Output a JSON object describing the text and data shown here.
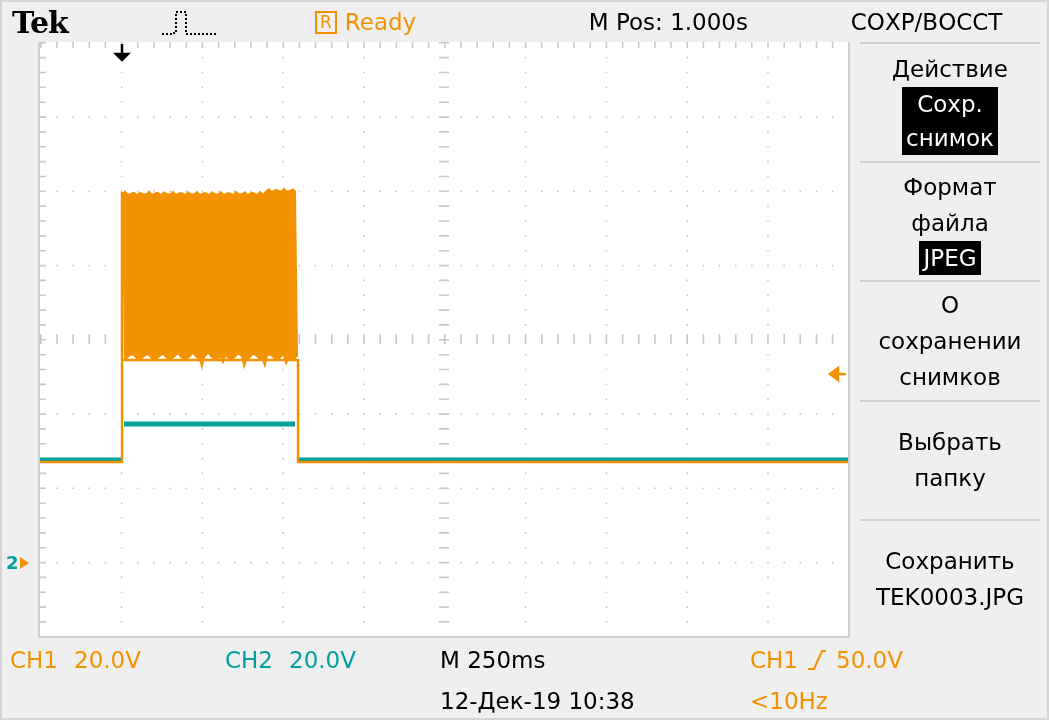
{
  "header": {
    "logo": "Tek",
    "run_badge": "R",
    "run_status": "Ready",
    "position": "M Pos: 1.000s",
    "menu_title": "СОХР/ВОССТ"
  },
  "screen": {
    "marker": "2"
  },
  "menu": [
    {
      "label": "Действие",
      "value": "Сохр.\nснимок"
    },
    {
      "label": "Формат\nфайла",
      "value": "JPEG"
    },
    {
      "label": "О\nсохранении\nснимков"
    },
    {
      "label": "Выбрать\nпапку"
    },
    {
      "label": "Сохранить\nTEK0003.JPG"
    }
  ],
  "footer": {
    "channels": [
      {
        "name": "CH1",
        "scale": "20.0V",
        "color": "#f39200"
      },
      {
        "name": "CH2",
        "scale": "20.0V",
        "color": "#00a0a0"
      }
    ],
    "timebase": "M 250ms",
    "datetime": "12-Дек-19 10:38",
    "trigger": {
      "source": "CH1",
      "level": "50.0V",
      "frequency": "<10Hz"
    }
  }
}
